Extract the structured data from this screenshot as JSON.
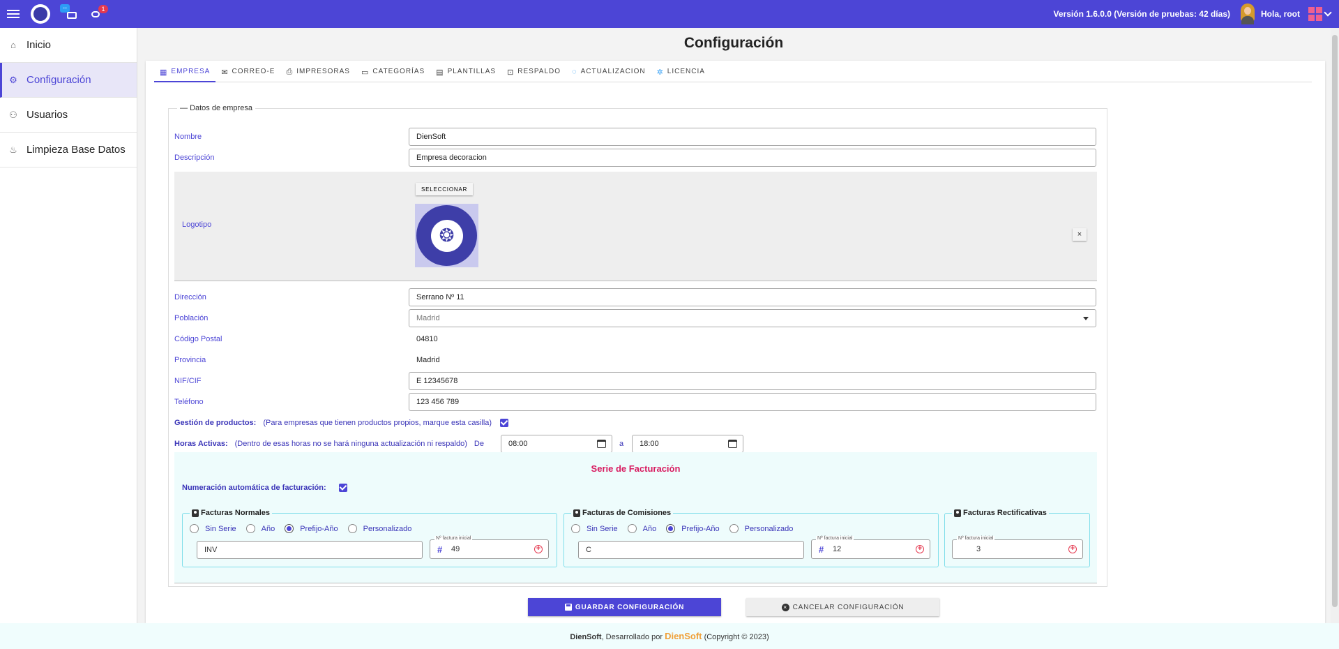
{
  "topbar": {
    "mail_badge": "--",
    "msg_badge": "1",
    "version": "Versión 1.6.0.0 (Versión de pruebas: 42 días)",
    "greeting": "Hola, root"
  },
  "sidebar": {
    "items": [
      {
        "label": "Inicio",
        "icon": "home-icon"
      },
      {
        "label": "Configuración",
        "icon": "gear-icon"
      },
      {
        "label": "Usuarios",
        "icon": "users-icon"
      },
      {
        "label": "Limpieza Base Datos",
        "icon": "broom-icon"
      }
    ]
  },
  "page": {
    "title": "Configuración"
  },
  "tabs": [
    {
      "label": "EMPRESA",
      "icon": "building-icon"
    },
    {
      "label": "CORREO-E",
      "icon": "mail-icon"
    },
    {
      "label": "IMPRESORAS",
      "icon": "printer-icon"
    },
    {
      "label": "CATEGORÍAS",
      "icon": "folder-icon"
    },
    {
      "label": "PLANTILLAS",
      "icon": "template-icon"
    },
    {
      "label": "RESPALDO",
      "icon": "backup-icon"
    },
    {
      "label": "ACTUALIZACION",
      "icon": "update-icon"
    },
    {
      "label": "LICENCIA",
      "icon": "license-icon"
    }
  ],
  "form": {
    "legend": "Datos de empresa",
    "nombre_label": "Nombre",
    "nombre_value": "DienSoft",
    "descripcion_label": "Descripción",
    "descripcion_value": "Empresa decoracion",
    "logotipo_label": "Logotipo",
    "seleccionar_label": "SELECCIONAR",
    "close_label": "×",
    "direccion_label": "Dirección",
    "direccion_value": "Serrano Nº 11",
    "poblacion_label": "Población",
    "poblacion_value": "Madrid",
    "cp_label": "Código Postal",
    "cp_value": "04810",
    "provincia_label": "Provincia",
    "provincia_value": "Madrid",
    "nif_label": "NIF/CIF",
    "nif_value": "E 12345678",
    "telefono_label": "Teléfono",
    "telefono_value": "123 456 789",
    "gestion_label": "Gestión de productos:",
    "gestion_note": "(Para empresas que tienen productos propios, marque esta casilla)",
    "gestion_checked": true,
    "horas_label": "Horas Activas:",
    "horas_note": "(Dentro de esas horas no se hará ninguna actualización ni respaldo)",
    "de_label": "De",
    "de_value": "08:00",
    "a_label": "a",
    "a_value": "18:00"
  },
  "serie": {
    "title": "Serie de Facturación",
    "auto_label": "Numeración automática de facturación:",
    "auto_checked": true,
    "radio_options": [
      "Sin Serie",
      "Año",
      "Prefijo-Año",
      "Personalizado"
    ],
    "num_label": "Nº factura inicial",
    "normales": {
      "title": "Facturas Normales",
      "selected": "Prefijo-Año",
      "serie": "INV",
      "numero": "49"
    },
    "comisiones": {
      "title": "Facturas de Comisiones",
      "selected": "Prefijo-Año",
      "serie": "C",
      "numero": "12"
    },
    "rectificativas": {
      "title": "Facturas Rectificativas",
      "numero": "3"
    }
  },
  "buttons": {
    "save": "GUARDAR CONFIGURACIÓN",
    "cancel": "CANCELAR CONFIGURACIÓN"
  },
  "footer": {
    "brand": "DienSoft",
    "text1": ", Desarrollado por ",
    "dev_brand": "DienSoft",
    "text2": " (Copyright © 2023)"
  },
  "colors": {
    "primary": "#4c45d6",
    "accent": "#d81b60",
    "danger": "#e53950"
  }
}
